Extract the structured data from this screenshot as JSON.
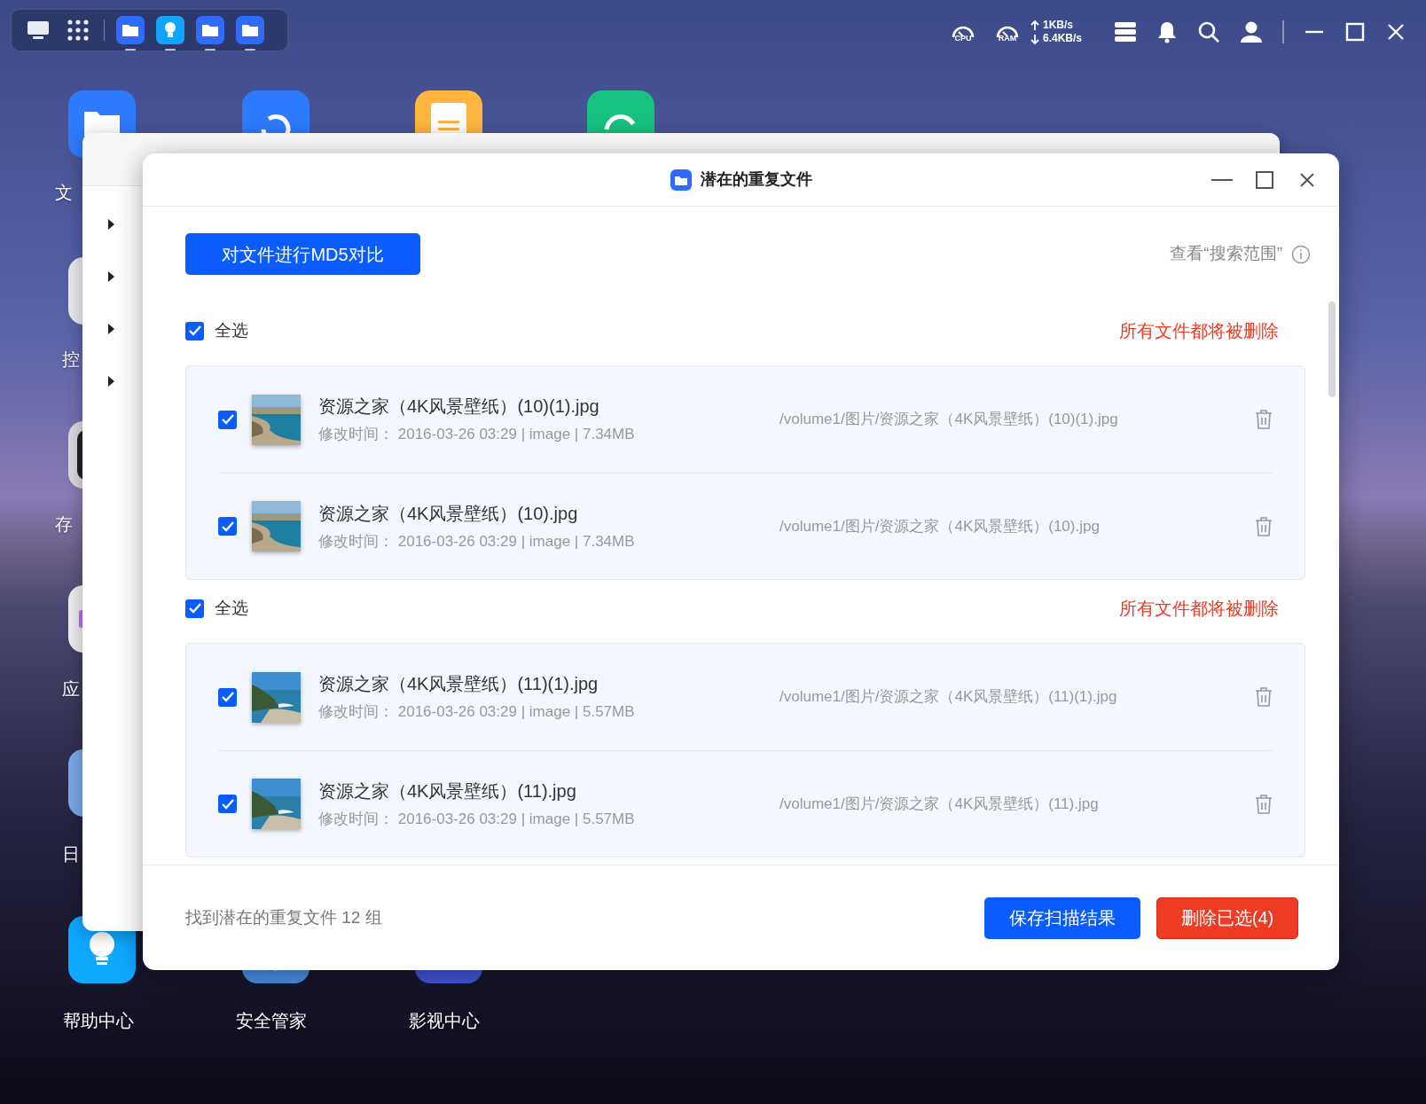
{
  "dock": [
    {
      "kind": "desktop",
      "running": false
    },
    {
      "kind": "apps",
      "running": false
    },
    {
      "kind": "folder",
      "running": true
    },
    {
      "kind": "bulb",
      "running": true
    },
    {
      "kind": "folder",
      "running": true
    },
    {
      "kind": "folder",
      "running": true
    }
  ],
  "status": {
    "cpu_label": "CPU",
    "ram_label": "RAM",
    "upload": "1KB/s",
    "download": "6.4KB/s"
  },
  "desktop_icons": [
    {
      "kind": "folder",
      "label": "文"
    },
    {
      "kind": "control",
      "label": "控"
    },
    {
      "kind": "storage",
      "label": "存"
    },
    {
      "kind": "app",
      "label": "应"
    },
    {
      "kind": "calendar",
      "label": "日"
    },
    {
      "kind": "bulb",
      "label": "帮助中心"
    },
    {
      "kind": "restore"
    },
    {
      "kind": "shield",
      "label": "安全管家"
    },
    {
      "kind": "notes"
    },
    {
      "kind": "video",
      "label": "影视中心"
    },
    {
      "kind": "sync"
    }
  ],
  "back_window": {
    "sidebar_items": [
      {
        "expanded": false
      },
      {
        "expanded": false
      },
      {
        "expanded": false
      },
      {
        "expanded": false
      }
    ]
  },
  "dialog": {
    "title": "潜在的重复文件",
    "compare_button": "对文件进行MD5对比",
    "scope_link": "查看“搜索范围”",
    "groups": [
      {
        "select_all": "全选",
        "checked": true,
        "warning": "所有文件都将被删除",
        "files": [
          {
            "name": "资源之家（4K风景壁纸）(10)(1).jpg",
            "meta_label": "修改时间：",
            "meta": "2016-03-26 03:29 | image | 7.34MB",
            "path": "/volume1/图片/资源之家（4K风景壁纸）(10)(1).jpg",
            "checked": true
          },
          {
            "name": "资源之家（4K风景壁纸）(10).jpg",
            "meta_label": "修改时间：",
            "meta": "2016-03-26 03:29 | image | 7.34MB",
            "path": "/volume1/图片/资源之家（4K风景壁纸）(10).jpg",
            "checked": true
          }
        ]
      },
      {
        "select_all": "全选",
        "checked": true,
        "warning": "所有文件都将被删除",
        "files": [
          {
            "name": "资源之家（4K风景壁纸）(11)(1).jpg",
            "meta_label": "修改时间：",
            "meta": "2016-03-26 03:29 | image | 5.57MB",
            "path": "/volume1/图片/资源之家（4K风景壁纸）(11)(1).jpg",
            "checked": true
          },
          {
            "name": "资源之家（4K风景壁纸）(11).jpg",
            "meta_label": "修改时间：",
            "meta": "2016-03-26 03:29 | image | 5.57MB",
            "path": "/volume1/图片/资源之家（4K风景壁纸）(11).jpg",
            "checked": true
          }
        ]
      }
    ],
    "found_text": "找到潜在的重复文件 12 组",
    "save_button": "保存扫描结果",
    "delete_button": "删除已选(4)"
  }
}
